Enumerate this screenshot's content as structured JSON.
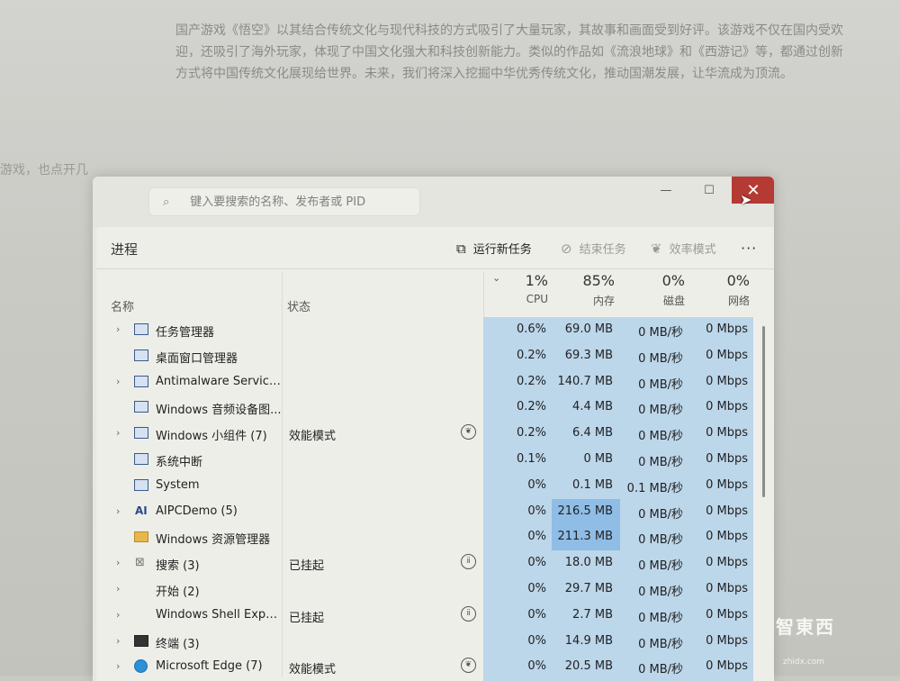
{
  "background_document": {
    "paragraph": "国产游戏《悟空》以其结合传统文化与现代科技的方式吸引了大量玩家，其故事和画面受到好评。该游戏不仅在国内受欢迎，还吸引了海外玩家，体现了中国文化强大和科技创新能力。类似的作品如《流浪地球》和《西游记》等，都通过创新方式将中国传统文化展现给世界。未来，我们将深入挖掘中华优秀传统文化，推动国潮发展，让华流成为顶流。",
    "fragment": "游戏，也点开几"
  },
  "window": {
    "search_placeholder": "键入要搜索的名称、发布者或 PID",
    "min_symbol": "—",
    "max_symbol": "☐",
    "close_symbol": "✕"
  },
  "toolbar": {
    "section_title": "进程",
    "run_new_task": "运行新任务",
    "end_task": "结束任务",
    "efficiency_mode": "效率模式",
    "more": "···"
  },
  "columns": {
    "name": "名称",
    "status": "状态",
    "cpu": {
      "percent": "1%",
      "label": "CPU"
    },
    "memory": {
      "percent": "85%",
      "label": "内存"
    },
    "disk": {
      "percent": "0%",
      "label": "磁盘"
    },
    "network": {
      "percent": "0%",
      "label": "网络"
    }
  },
  "processes": [
    {
      "name": "任务管理器",
      "status": "",
      "cpu": "0.6%",
      "memory": "69.0 MB",
      "disk": "0 MB/秒",
      "network": "0 Mbps"
    },
    {
      "name": "桌面窗口管理器",
      "status": "",
      "cpu": "0.2%",
      "memory": "69.3 MB",
      "disk": "0 MB/秒",
      "network": "0 Mbps"
    },
    {
      "name": "Antimalware Service...",
      "status": "",
      "cpu": "0.2%",
      "memory": "140.7 MB",
      "disk": "0 MB/秒",
      "network": "0 Mbps"
    },
    {
      "name": "Windows 音频设备图...",
      "status": "",
      "cpu": "0.2%",
      "memory": "4.4 MB",
      "disk": "0 MB/秒",
      "network": "0 Mbps"
    },
    {
      "name": "Windows 小组件 (7)",
      "status": "效能模式",
      "cpu": "0.2%",
      "memory": "6.4 MB",
      "disk": "0 MB/秒",
      "network": "0 Mbps"
    },
    {
      "name": "系统中断",
      "status": "",
      "cpu": "0.1%",
      "memory": "0 MB",
      "disk": "0 MB/秒",
      "network": "0 Mbps"
    },
    {
      "name": "System",
      "status": "",
      "cpu": "0%",
      "memory": "0.1 MB",
      "disk": "0.1 MB/秒",
      "network": "0 Mbps"
    },
    {
      "name": "AIPCDemo (5)",
      "status": "",
      "cpu": "0%",
      "memory": "216.5 MB",
      "disk": "0 MB/秒",
      "network": "0 Mbps"
    },
    {
      "name": "Windows 资源管理器",
      "status": "",
      "cpu": "0%",
      "memory": "211.3 MB",
      "disk": "0 MB/秒",
      "network": "0 Mbps"
    },
    {
      "name": "搜索 (3)",
      "status": "已挂起",
      "cpu": "0%",
      "memory": "18.0 MB",
      "disk": "0 MB/秒",
      "network": "0 Mbps"
    },
    {
      "name": "开始 (2)",
      "status": "",
      "cpu": "0%",
      "memory": "29.7 MB",
      "disk": "0 MB/秒",
      "network": "0 Mbps"
    },
    {
      "name": "Windows Shell Expe...",
      "status": "已挂起",
      "cpu": "0%",
      "memory": "2.7 MB",
      "disk": "0 MB/秒",
      "network": "0 Mbps"
    },
    {
      "name": "终端 (3)",
      "status": "",
      "cpu": "0%",
      "memory": "14.9 MB",
      "disk": "0 MB/秒",
      "network": "0 Mbps"
    },
    {
      "name": "Microsoft Edge (7)",
      "status": "效能模式",
      "cpu": "0%",
      "memory": "20.5 MB",
      "disk": "0 MB/秒",
      "network": "0 Mbps"
    }
  ],
  "watermark": {
    "brand": "智東西",
    "site": "zhidx.com"
  },
  "colors": {
    "highlight": "#bcd6ea",
    "memory_high": "#8fbde6",
    "close": "#b53a33"
  }
}
